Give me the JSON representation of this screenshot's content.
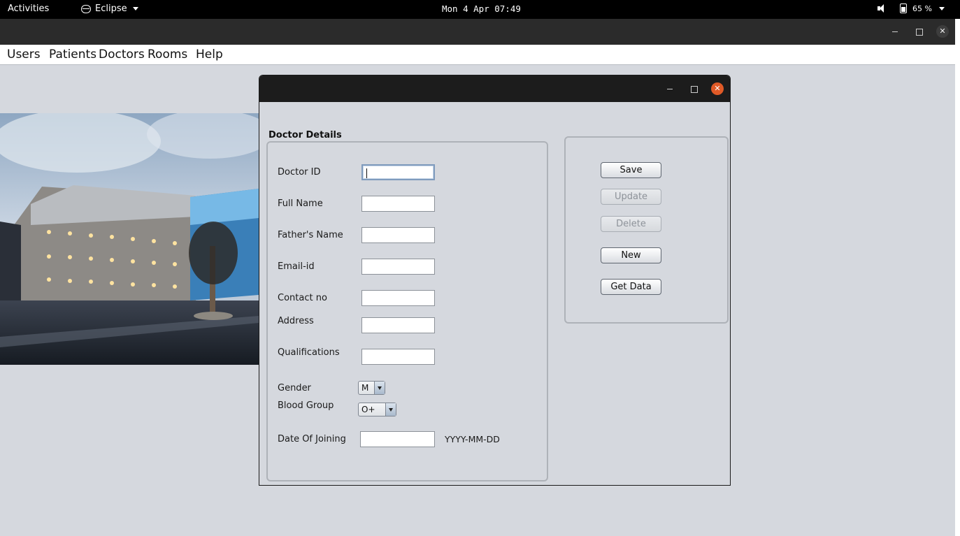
{
  "topbar": {
    "activities": "Activities",
    "app_name": "Eclipse",
    "clock": "Mon 4 Apr 07:49",
    "battery": "65 %"
  },
  "menubar": {
    "items": [
      "Users",
      "Patients",
      "Doctors",
      "Rooms",
      "Help"
    ]
  },
  "dialog": {
    "panel_title": "Doctor Details",
    "fields": {
      "doctor_id": {
        "label": "Doctor ID",
        "value": ""
      },
      "full_name": {
        "label": "Full Name",
        "value": ""
      },
      "fathers_name": {
        "label": "Father's Name",
        "value": ""
      },
      "email": {
        "label": "Email-id",
        "value": ""
      },
      "contact": {
        "label": "Contact no",
        "value": ""
      },
      "address": {
        "label": "Address",
        "value": ""
      },
      "qualifications": {
        "label": "Qualifications",
        "value": ""
      },
      "gender": {
        "label": "Gender",
        "value": "M"
      },
      "blood_group": {
        "label": "Blood Group",
        "value": "O+"
      },
      "date_of_joining": {
        "label": "Date Of Joining",
        "value": "",
        "hint": "YYYY-MM-DD"
      }
    },
    "buttons": {
      "save": "Save",
      "update": "Update",
      "delete": "Delete",
      "new": "New",
      "get_data": "Get Data"
    }
  },
  "colors": {
    "close_accent": "#e05a27",
    "window_bg": "#d5d8de"
  }
}
